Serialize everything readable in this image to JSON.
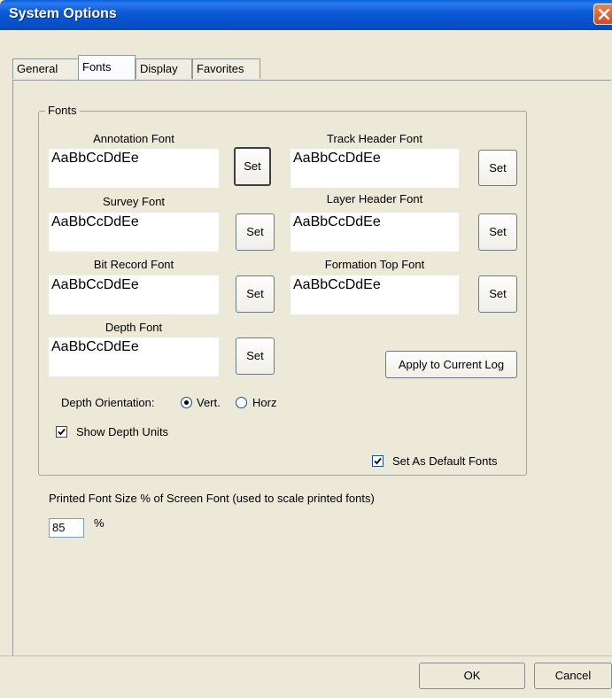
{
  "window": {
    "title": "System Options"
  },
  "tabs": [
    {
      "label": "General",
      "active": false
    },
    {
      "label": "Fonts",
      "active": true
    },
    {
      "label": "Display",
      "active": false
    },
    {
      "label": "Favorites",
      "active": false
    }
  ],
  "fonts_group": {
    "legend": "Fonts",
    "fields": [
      {
        "label": "Annotation Font",
        "sample": "AaBbCcDdEe",
        "button": "Set"
      },
      {
        "label": "Track Header Font",
        "sample": "AaBbCcDdEe",
        "button": "Set"
      },
      {
        "label": "Survey Font",
        "sample": "AaBbCcDdEe",
        "button": "Set"
      },
      {
        "label": "Layer Header Font",
        "sample": "AaBbCcDdEe",
        "button": "Set"
      },
      {
        "label": "Bit Record Font",
        "sample": "AaBbCcDdEe",
        "button": "Set"
      },
      {
        "label": "Formation Top Font",
        "sample": "AaBbCcDdEe",
        "button": "Set"
      },
      {
        "label": "Depth Font",
        "sample": "AaBbCcDdEe",
        "button": "Set"
      }
    ],
    "apply_button": "Apply to Current Log",
    "depth_orientation": {
      "label": "Depth Orientation:",
      "options": [
        "Vert.",
        "Horz"
      ],
      "selected": "Vert."
    },
    "show_depth_units": {
      "label": "Show Depth Units",
      "checked": true
    },
    "set_default": {
      "label": "Set As Default Fonts",
      "checked": true
    }
  },
  "printed_font": {
    "label": "Printed Font Size % of Screen Font (used to scale printed fonts)",
    "value": "85",
    "unit": "%"
  },
  "footer": {
    "ok": "OK",
    "cancel": "Cancel"
  }
}
